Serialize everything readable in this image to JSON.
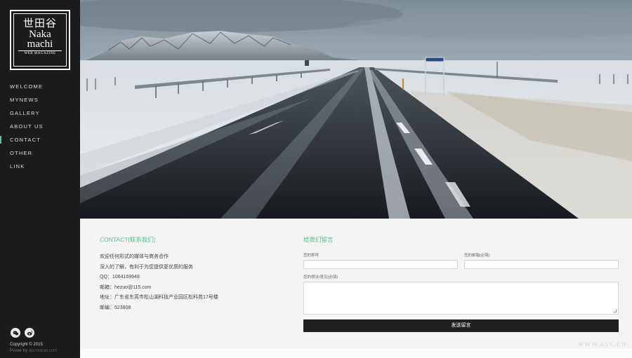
{
  "logo": {
    "kanji": "世田谷",
    "line1": "Naka",
    "line2": "machi",
    "subtitle": "WEB MAGAZINE"
  },
  "nav": {
    "items": [
      {
        "label": "WELCOME"
      },
      {
        "label": "MYNEWS"
      },
      {
        "label": "GALLERY"
      },
      {
        "label": "ABOUT US"
      },
      {
        "label": "CONTACT"
      },
      {
        "label": "OTHER"
      },
      {
        "label": "LINK"
      }
    ],
    "active": "CONTACT"
  },
  "social": {
    "icons": [
      "wechat-icon",
      "weibo-icon"
    ]
  },
  "footer": {
    "copyright": "Copyright © 2015",
    "power_prefix": "Power by",
    "power_link": "alicmoban.com"
  },
  "contact": {
    "title": "CONTACT[联系我们]",
    "lines": [
      "欢迎任何形式的媒体与商务合作",
      "深入的了解，有利于为您提供更优质的服务",
      "QQ：1064169948",
      "邮箱：hezuo@115.com",
      "地址：广东省东莞市松山湖科技产业园区松科苑17号楼",
      "邮编：523808"
    ]
  },
  "form": {
    "title": "给我们留言",
    "name_label": "您的称呼",
    "email_label": "您的邮箱(必填)",
    "message_label": "您的想法/意见(必填)",
    "submit_label": "发送留言"
  },
  "watermark": "www.ayc.cn",
  "colors": {
    "accent": "#59c28c",
    "sidebar": "#1b1b1b",
    "button": "#1f1f1f"
  }
}
